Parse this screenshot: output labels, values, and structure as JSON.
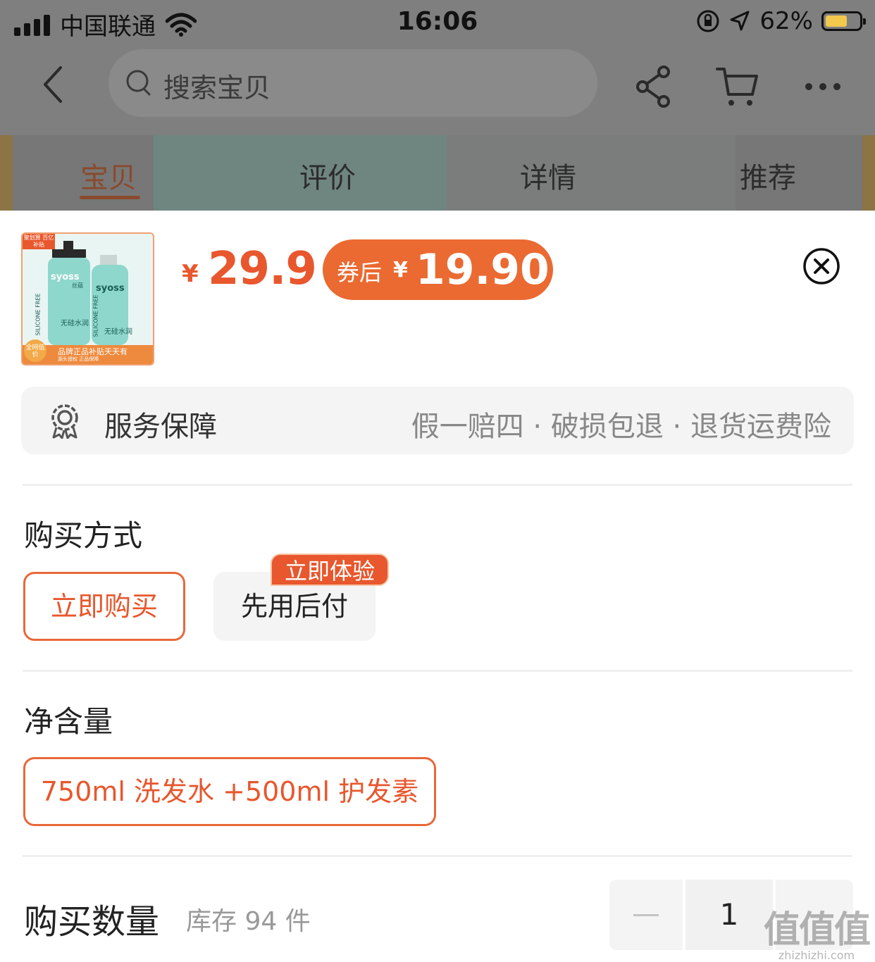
{
  "status_bar": {
    "carrier": "中国联通",
    "time": "16:06",
    "battery_percent": "62%"
  },
  "header": {
    "search_placeholder": "搜索宝贝",
    "icons": [
      "back-icon",
      "search-icon",
      "share-icon",
      "cart-icon",
      "more-icon"
    ]
  },
  "tabs": [
    "宝贝",
    "评价",
    "详情",
    "推荐"
  ],
  "tabs_active": "宝贝",
  "product": {
    "thumbnail_texts": {
      "corner_tag": "聚划算 百亿补贴",
      "brand": "syoss",
      "brand_cn": "丝蕴",
      "line": "SILICONE FREE",
      "variant": "无硅水润",
      "promo_badge": "全网低价",
      "promo_line": "品牌正品补贴天天有",
      "promo_sub": "源头授权 正品保障"
    },
    "price_symbol": "¥",
    "price": "29.9",
    "coupon_label": "券后",
    "coupon_symbol": "¥",
    "coupon_price": "19.90"
  },
  "service": {
    "title": "服务保障",
    "items": "假一赔四 · 破损包退 · 退货运费险"
  },
  "purchase_method": {
    "title": "购买方式",
    "options": [
      "立即购买",
      "先用后付"
    ],
    "selected": "立即购买",
    "badge": "立即体验"
  },
  "net_content": {
    "title": "净含量",
    "options": [
      "750ml 洗发水 +500ml 护发素"
    ],
    "selected": "750ml 洗发水 +500ml 护发素"
  },
  "quantity": {
    "title": "购买数量",
    "stock": "库存 94 件",
    "value": "1"
  },
  "watermark": {
    "text": "值值值",
    "domain": "zhizhizhi.com"
  },
  "colors": {
    "accent": "#e8572d",
    "coupon_bg": "#ea6a32",
    "overlay": "#7f7f7f"
  }
}
